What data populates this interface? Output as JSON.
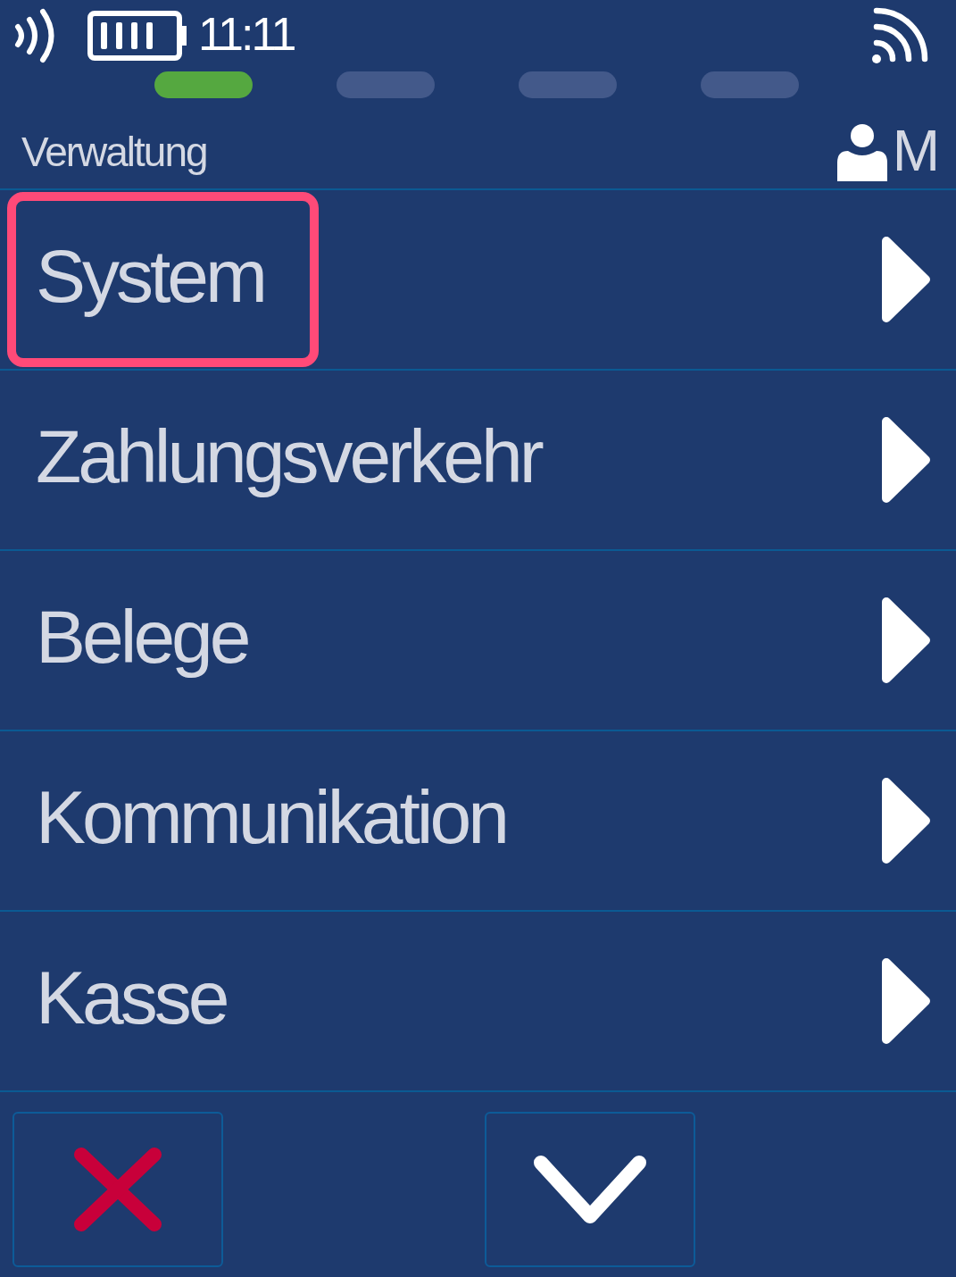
{
  "status_bar": {
    "time": "11:11"
  },
  "page_indicator": [
    {
      "selected": true
    },
    {
      "selected": false
    },
    {
      "selected": false
    },
    {
      "selected": false
    }
  ],
  "header": {
    "title": "Verwaltung",
    "user": "M"
  },
  "menu": [
    {
      "label": "System",
      "selected": true
    },
    {
      "label": "Zahlungsverkehr",
      "selected": false
    },
    {
      "label": "Belege",
      "selected": false
    },
    {
      "label": "Kommunikation",
      "selected": false
    },
    {
      "label": "Kasse",
      "selected": false
    }
  ],
  "buttons": [
    {
      "kind": "cancel"
    },
    {
      "kind": "confirm"
    }
  ]
}
